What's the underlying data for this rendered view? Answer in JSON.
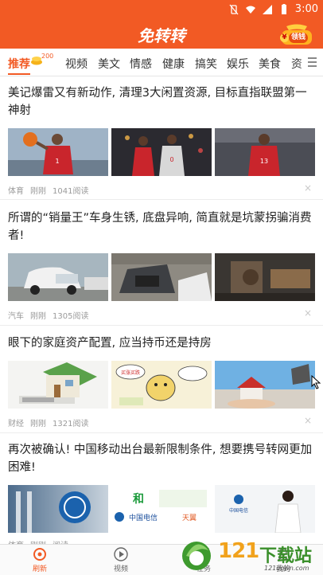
{
  "status": {
    "time": "3:00"
  },
  "header": {
    "title": "免转转",
    "claim_label": "领钱",
    "claim_currency": "¥"
  },
  "tabs": {
    "items": [
      "推荐",
      "视频",
      "美文",
      "情感",
      "健康",
      "搞笑",
      "娱乐",
      "美食",
      "资"
    ],
    "badge": "200"
  },
  "articles": [
    {
      "title": "美记爆雷又有新动作, 清理3大闲置资源, 目标直指联盟第一神射",
      "category": "体育",
      "time": "刚刚",
      "reads": "1041阅读"
    },
    {
      "title": "所谓的“销量王”车身生锈, 底盘异响, 简直就是坑蒙拐骗消费者!",
      "category": "汽车",
      "time": "刚刚",
      "reads": "1305阅读"
    },
    {
      "title": "眼下的家庭资产配置, 应当持币还是持房",
      "category": "财经",
      "time": "刚刚",
      "reads": "1321阅读"
    },
    {
      "title": "再次被确认! 中国移动出台最新限制条件, 想要携号转网更加困难!",
      "category": "体育",
      "time": "刚刚",
      "reads": "阅读"
    }
  ],
  "thumb_text": {
    "ad_text_1": "和",
    "ad_text_2": "中国电信",
    "ad_text_3": "天翼",
    "cartoon_text": "买涨买跌"
  },
  "dismiss_icon": "×",
  "bottom_nav": {
    "items": [
      "刷新",
      "视频",
      "任务",
      "我的"
    ]
  },
  "watermark": {
    "text_a": "121",
    "text_b": "下载站",
    "site": "121down.com"
  },
  "colors": {
    "brand": "#f25a24",
    "meta_text": "#9a9a9a"
  }
}
